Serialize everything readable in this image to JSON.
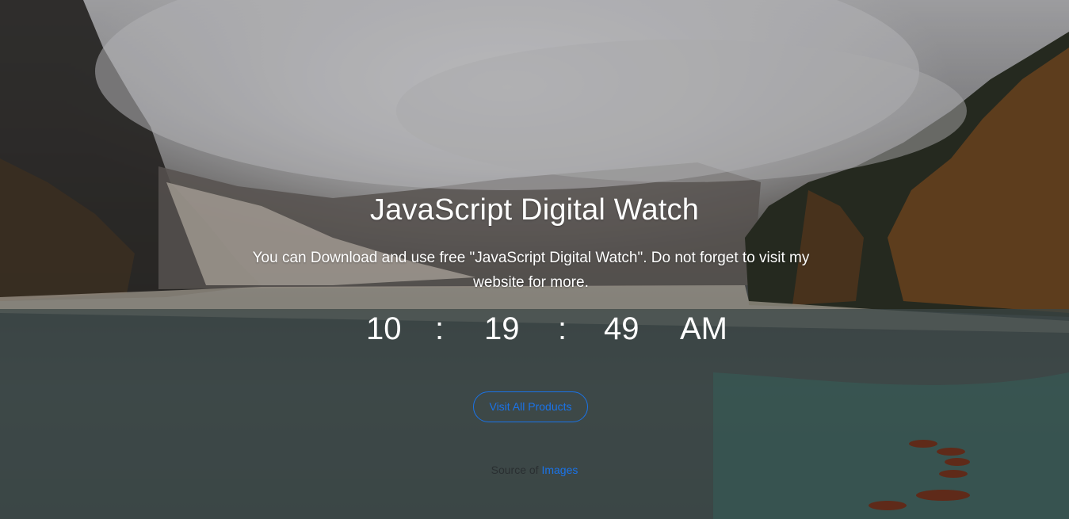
{
  "page": {
    "title": "JavaScript Digital Watch",
    "description": "You can Download and use free \"JavaScript Digital Watch\". Do not forget to visit my website for more."
  },
  "clock": {
    "hours": "10",
    "separator1": ":",
    "minutes": "19",
    "separator2": ":",
    "seconds": "49",
    "period": "AM"
  },
  "cta": {
    "label": "Visit All Products"
  },
  "source": {
    "prefix": "Source of",
    "link_label": "Images"
  },
  "colors": {
    "accent": "#1a73e8",
    "text": "#ffffff"
  }
}
